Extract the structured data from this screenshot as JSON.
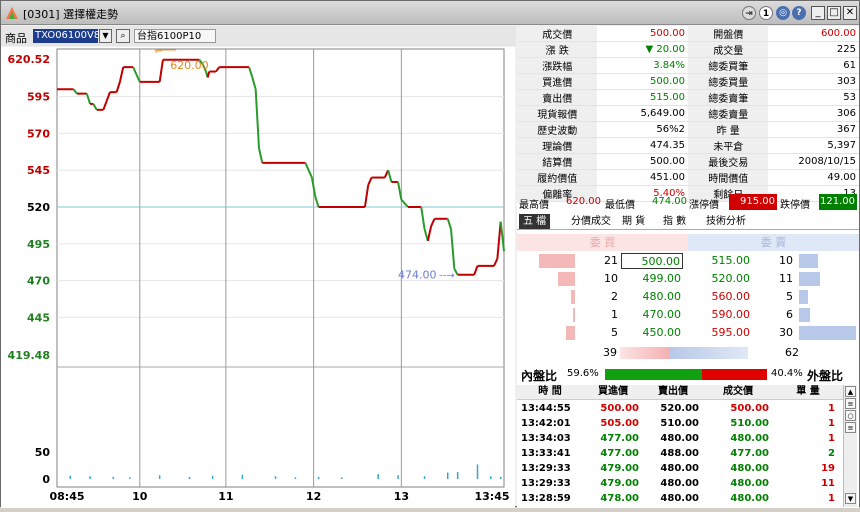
{
  "window": {
    "title": "[0301] 選擇權走勢"
  },
  "toolbar": {
    "product_label": "商品",
    "product_code": "TXO06100V8",
    "product_name": "台指6100P10"
  },
  "chart": {
    "y_labels": [
      "620.52",
      "595",
      "570",
      "545",
      "520",
      "495",
      "470",
      "445",
      "419.48",
      "50",
      "0"
    ],
    "x_labels": [
      "08:45",
      "10",
      "11",
      "12",
      "13",
      "13:45"
    ],
    "high_annotation": "620.00",
    "low_annotation": "474.00",
    "ref_price": 520,
    "price_series": [
      [
        0,
        600
      ],
      [
        5,
        600
      ],
      [
        6,
        597
      ],
      [
        9,
        597
      ],
      [
        10,
        590
      ],
      [
        11,
        590
      ],
      [
        12,
        586
      ],
      [
        14,
        586
      ],
      [
        15,
        592
      ],
      [
        16,
        598
      ],
      [
        18,
        598
      ],
      [
        19,
        605
      ],
      [
        20,
        615
      ],
      [
        23,
        615
      ],
      [
        24,
        610
      ],
      [
        25,
        605
      ],
      [
        26,
        605
      ],
      [
        31,
        605
      ],
      [
        32,
        620
      ],
      [
        40,
        620
      ],
      [
        43,
        620
      ],
      [
        44,
        617
      ],
      [
        45,
        612
      ],
      [
        45.5,
        608
      ],
      [
        46,
        612
      ],
      [
        48,
        612
      ],
      [
        49,
        615
      ],
      [
        58,
        615
      ],
      [
        59,
        608
      ],
      [
        60,
        600
      ],
      [
        61,
        560
      ],
      [
        62,
        550
      ],
      [
        75,
        550
      ],
      [
        77,
        540
      ],
      [
        78,
        527
      ],
      [
        79,
        520
      ],
      [
        93,
        520
      ],
      [
        94,
        535
      ],
      [
        95,
        540
      ],
      [
        99,
        540
      ],
      [
        100,
        545
      ],
      [
        101,
        537
      ],
      [
        103,
        537
      ],
      [
        104,
        525
      ],
      [
        106,
        520
      ],
      [
        110,
        520
      ],
      [
        111,
        505
      ],
      [
        112,
        497
      ],
      [
        113,
        507
      ],
      [
        114,
        512
      ],
      [
        118,
        512
      ],
      [
        119,
        505
      ],
      [
        120,
        478
      ],
      [
        121,
        474
      ],
      [
        126,
        474
      ],
      [
        127,
        480
      ],
      [
        132,
        480
      ],
      [
        133,
        485
      ],
      [
        134,
        510
      ],
      [
        135,
        490
      ]
    ],
    "volumes": [
      [
        4,
        6
      ],
      [
        10,
        5
      ],
      [
        17,
        4
      ],
      [
        22,
        3
      ],
      [
        31,
        7
      ],
      [
        40,
        4
      ],
      [
        47,
        6
      ],
      [
        56,
        8
      ],
      [
        66,
        5
      ],
      [
        72,
        3
      ],
      [
        79,
        4
      ],
      [
        86,
        3
      ],
      [
        97,
        9
      ],
      [
        103,
        7
      ],
      [
        111,
        5
      ],
      [
        118,
        12
      ],
      [
        121,
        13
      ],
      [
        127,
        27
      ],
      [
        131,
        5
      ],
      [
        134,
        4
      ]
    ]
  },
  "quote": {
    "rows": [
      {
        "l1": "成交價",
        "v1": "500.00",
        "c1": "red",
        "l2": "開盤價",
        "v2": "600.00",
        "c2": "red"
      },
      {
        "l1": "漲 跌",
        "v1": "▼ 20.00",
        "c1": "green",
        "l2": "成交量",
        "v2": "225",
        "c2": "blk"
      },
      {
        "l1": "漲跌幅",
        "v1": "3.84%",
        "c1": "green",
        "l2": "總委買筆",
        "v2": "61",
        "c2": "blk"
      },
      {
        "l1": "買進價",
        "v1": "500.00",
        "c1": "green",
        "l2": "總委買量",
        "v2": "303",
        "c2": "blk"
      },
      {
        "l1": "賣出價",
        "v1": "515.00",
        "c1": "green",
        "l2": "總委賣筆",
        "v2": "53",
        "c2": "blk"
      },
      {
        "l1": "現貨報價",
        "v1": "5,649.00",
        "c1": "blk",
        "l2": "總委賣量",
        "v2": "306",
        "c2": "blk"
      },
      {
        "l1": "歷史波動",
        "v1": "56%2",
        "c1": "blk",
        "l2": "昨 量",
        "v2": "367",
        "c2": "blk"
      },
      {
        "l1": "理論價",
        "v1": "474.35",
        "c1": "blk",
        "l2": "未平倉",
        "v2": "5,397",
        "c2": "blk"
      },
      {
        "l1": "結算價",
        "v1": "500.00",
        "c1": "blk",
        "l2": "最後交易",
        "v2": "2008/10/15",
        "c2": "blk"
      },
      {
        "l1": "履約價值",
        "v1": "451.00",
        "c1": "blk",
        "l2": "時間價值",
        "v2": "49.00",
        "c2": "blk"
      },
      {
        "l1": "偏離率",
        "v1": "5.40%",
        "c1": "red",
        "l2": "剩餘日",
        "v2": "13",
        "c2": "blk"
      }
    ],
    "bottom": {
      "hi_l": "最高價",
      "hi_v": "620.00",
      "lo_l": "最低價",
      "lo_v": "474.00",
      "up_l": "漲停價",
      "up_v": "915.00",
      "dn_l": "跌停價",
      "dn_v": "121.00"
    }
  },
  "tabs": [
    "五 檔",
    "分價成交",
    "期 貨",
    "指 數",
    "技術分析"
  ],
  "orderbook": {
    "bid_header": "委 買",
    "ask_header": "委 賣",
    "rows": [
      {
        "bq": "21",
        "bp": "500.00",
        "ap": "515.00",
        "aq": "10",
        "bw": 36,
        "aw": 19
      },
      {
        "bq": "10",
        "bp": "499.00",
        "ap": "520.00",
        "aq": "11",
        "bw": 17,
        "aw": 21
      },
      {
        "bq": "2",
        "bp": "480.00",
        "ap": "560.00",
        "aq": "5",
        "bw": 4,
        "aw": 9
      },
      {
        "bq": "1",
        "bp": "470.00",
        "ap": "590.00",
        "aq": "6",
        "bw": 2,
        "aw": 11
      },
      {
        "bq": "5",
        "bp": "450.00",
        "ap": "595.00",
        "aq": "30",
        "bw": 9,
        "aw": 57
      }
    ],
    "bid_total": "39",
    "ask_total": "62"
  },
  "ratio": {
    "in_label": "內盤比",
    "in_pct": "59.6%",
    "out_label": "外盤比",
    "out_pct": "40.4%",
    "in_frac": 0.596
  },
  "ticks": {
    "headers": [
      "時 間",
      "買進價",
      "賣出價",
      "成交價",
      "單 量"
    ],
    "rows": [
      {
        "t": "13:44:55",
        "b": "500.00",
        "a": "520.00",
        "p": "500.00",
        "q": "1",
        "bc": "red",
        "pc": "red",
        "qc": "red"
      },
      {
        "t": "13:42:01",
        "b": "505.00",
        "a": "510.00",
        "p": "510.00",
        "q": "1",
        "bc": "red",
        "pc": "green",
        "qc": "red"
      },
      {
        "t": "13:34:03",
        "b": "477.00",
        "a": "480.00",
        "p": "480.00",
        "q": "1",
        "bc": "green",
        "pc": "green",
        "qc": "red"
      },
      {
        "t": "13:33:41",
        "b": "477.00",
        "a": "488.00",
        "p": "477.00",
        "q": "2",
        "bc": "green",
        "pc": "green",
        "qc": "green"
      },
      {
        "t": "13:29:33",
        "b": "479.00",
        "a": "480.00",
        "p": "480.00",
        "q": "19",
        "bc": "green",
        "pc": "green",
        "qc": "red"
      },
      {
        "t": "13:29:33",
        "b": "479.00",
        "a": "480.00",
        "p": "480.00",
        "q": "11",
        "bc": "green",
        "pc": "green",
        "qc": "red"
      },
      {
        "t": "13:28:59",
        "b": "478.00",
        "a": "480.00",
        "p": "480.00",
        "q": "1",
        "bc": "green",
        "pc": "green",
        "qc": "red"
      }
    ]
  }
}
